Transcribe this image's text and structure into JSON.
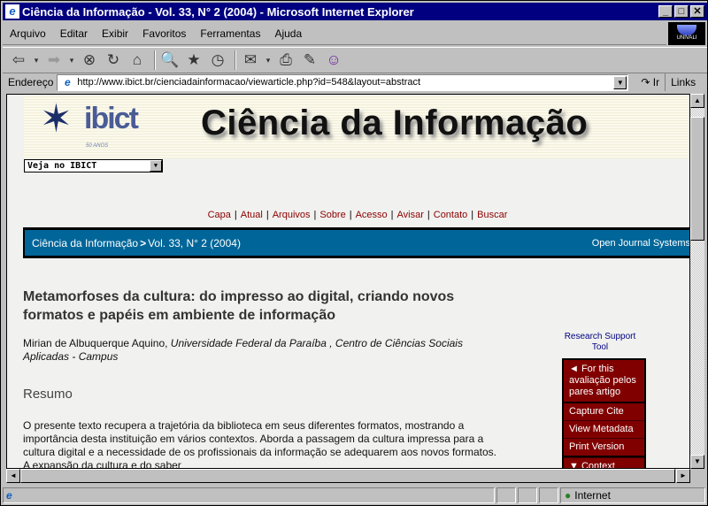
{
  "window": {
    "title": "Ciência da Informação - Vol. 33, N° 2 (2004) - Microsoft Internet Explorer",
    "buttons": {
      "minimize": "_",
      "maximize": "□",
      "close": "✕"
    }
  },
  "menu": [
    "Arquivo",
    "Editar",
    "Exibir",
    "Favoritos",
    "Ferramentas",
    "Ajuda"
  ],
  "brand_logo": "UNIVALI",
  "toolbar": {
    "back_icon": "⇦",
    "forward_icon": "➡",
    "dropdown_icon": "▾",
    "stop_icon": "⊗",
    "refresh_icon": "↻",
    "home_icon": "⌂",
    "search_icon": "🔍",
    "favorites_icon": "★",
    "history_icon": "◷",
    "mail_icon": "✉",
    "print_icon": "⎙",
    "edit_icon": "✎",
    "messenger_icon": "☺"
  },
  "address": {
    "label": "Endereço",
    "url": "http://www.ibict.br/cienciadainformacao/viewarticle.php?id=548&layout=abstract",
    "go_label": "Ir",
    "links_label": "Links"
  },
  "page": {
    "logo_word": "ibict",
    "logo_sub": "50 ANOS",
    "site_title": "Ciência da Informação",
    "site_select": "Veja no IBICT",
    "nav": [
      "Capa",
      "Atual",
      "Arquivos",
      "Sobre",
      "Acesso",
      "Avisar",
      "Contato",
      "Buscar"
    ],
    "breadcrumb": {
      "home": "Ciência da Informação",
      "separator": ">",
      "issue": "Vol. 33, N° 2 (2004)",
      "right": "Open Journal Systems"
    },
    "article": {
      "title": "Metamorfoses da cultura: do impresso ao digital, criando novos formatos e papéis em ambiente de informação",
      "author": "Mirian de Albuquerque Aquino,",
      "affiliation": "Universidade Federal da Paraíba , Centro de Ciências Sociais Aplicadas - Campus",
      "abstract_heading": "Resumo",
      "abstract": "O presente texto recupera a trajetória da biblioteca em seus diferentes formatos, mostrando a importância desta instituição em vários contextos. Aborda a passagem da cultura impressa para a cultura digital e a necessidade de os profissionais da informação se adequarem aos novos formatos. A expansão da cultura e do saber"
    },
    "rst": {
      "title": "Research Support Tool",
      "section_label": "◄ For this avaliação pelos pares artigo",
      "items": [
        "Capture Cite",
        "View Metadata",
        "Print Version"
      ],
      "context_label": "▼  Context"
    }
  },
  "status": {
    "zone": "Internet"
  }
}
